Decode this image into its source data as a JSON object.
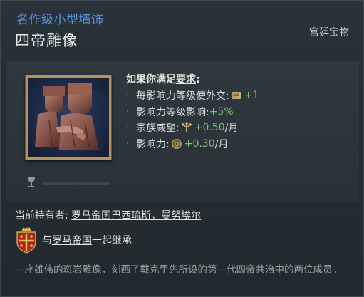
{
  "tooltip": {
    "rarity": "名作级小型墙饰",
    "title": "四帝雕像",
    "category": "宫廷宝物",
    "requirements": {
      "heading_prefix": "如果你满足",
      "heading_link": "要求",
      "heading_suffix": ":",
      "effects": [
        {
          "label": "每影响力等级使外交:",
          "icon": "scroll-icon",
          "value": "+1"
        },
        {
          "label": "影响力等级影响:",
          "icon": "",
          "value": "+5%"
        },
        {
          "label": "宗族威望:",
          "icon": "family-tree-icon",
          "value": "+0.50",
          "unit": "/月"
        },
        {
          "label": "影响力:",
          "icon": "influence-coin-icon",
          "value": "+0.30",
          "unit": "/月"
        }
      ]
    },
    "durability_icon": "goblet-icon",
    "holder": {
      "label": "当前持有者:",
      "name": "罗马帝国巴西琉斯，曼努埃尔"
    },
    "inheritance": {
      "prefix": "与",
      "link": "罗马帝国",
      "suffix": "一起继承",
      "icon": "roman-empire-coat-of-arms-icon"
    },
    "description": "一座雄伟的斑岩雕像，刻画了戴克里先所设的第一代四帝共治中的两位成员。"
  },
  "colors": {
    "rarity": "#5a8fd6",
    "positive_value": "#7dc26a",
    "description": "#9aa3a6"
  }
}
